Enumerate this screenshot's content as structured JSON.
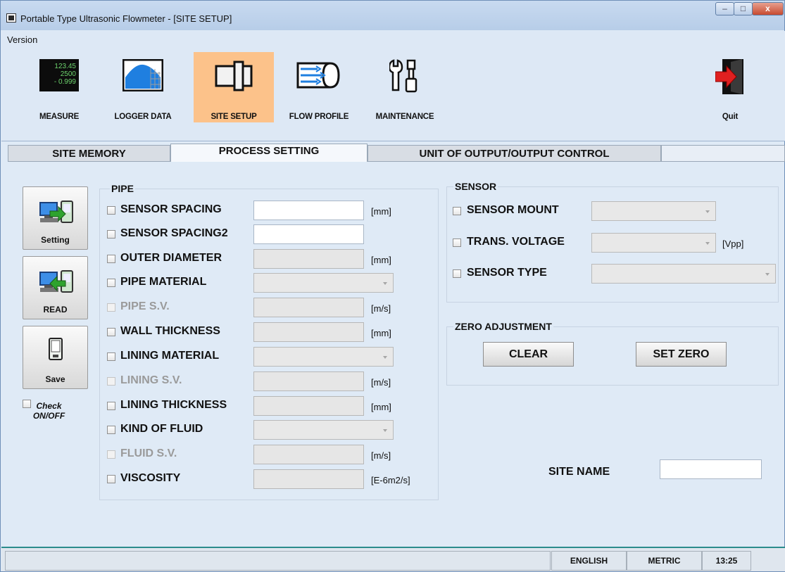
{
  "window": {
    "title": "Portable Type Ultrasonic Flowmeter - [SITE SETUP]"
  },
  "menu": {
    "version": "Version"
  },
  "toolbar": {
    "measure": "MEASURE",
    "measure_display": [
      "123.45",
      "2500",
      "- 0.999"
    ],
    "logger": "LOGGER DATA",
    "site_setup": "SITE SETUP",
    "flow_profile": "FLOW PROFILE",
    "maintenance": "MAINTENANCE",
    "quit": "Quit"
  },
  "tabs": {
    "site_memory": "SITE MEMORY",
    "process_setting": "PROCESS SETTING",
    "unit_output": "UNIT OF OUTPUT/OUTPUT CONTROL"
  },
  "side": {
    "setting": "Setting",
    "read": "READ",
    "save": "Save",
    "check": "Check ON/OFF"
  },
  "pipe": {
    "title": "PIPE",
    "rows": [
      {
        "label": "SENSOR SPACING",
        "unit": "[mm]"
      },
      {
        "label": "SENSOR SPACING2",
        "unit": ""
      },
      {
        "label": "OUTER DIAMETER",
        "unit": "[mm]"
      },
      {
        "label": "PIPE MATERIAL",
        "unit": ""
      },
      {
        "label": "PIPE S.V.",
        "unit": "[m/s]"
      },
      {
        "label": "WALL THICKNESS",
        "unit": "[mm]"
      },
      {
        "label": "LINING MATERIAL",
        "unit": ""
      },
      {
        "label": "LINING S.V.",
        "unit": "[m/s]"
      },
      {
        "label": "LINING THICKNESS",
        "unit": "[mm]"
      },
      {
        "label": "KIND OF FLUID",
        "unit": ""
      },
      {
        "label": "FLUID S.V.",
        "unit": "[m/s]"
      },
      {
        "label": "VISCOSITY",
        "unit": "[E-6m2/s]"
      }
    ]
  },
  "sensor": {
    "title": "SENSOR",
    "rows": [
      {
        "label": "SENSOR MOUNT",
        "unit": ""
      },
      {
        "label": "TRANS. VOLTAGE",
        "unit": "[Vpp]"
      },
      {
        "label": "SENSOR TYPE",
        "unit": ""
      }
    ]
  },
  "zero": {
    "title": "ZERO ADJUSTMENT",
    "clear": "CLEAR",
    "set_zero": "SET ZERO"
  },
  "site_name": {
    "label": "SITE NAME",
    "value": ""
  },
  "status": {
    "main": "",
    "language": "ENGLISH",
    "units": "METRIC",
    "time": "13:25"
  },
  "colors": {
    "active_tool": "#fcc28a",
    "status_line": "#2b8c8c"
  }
}
